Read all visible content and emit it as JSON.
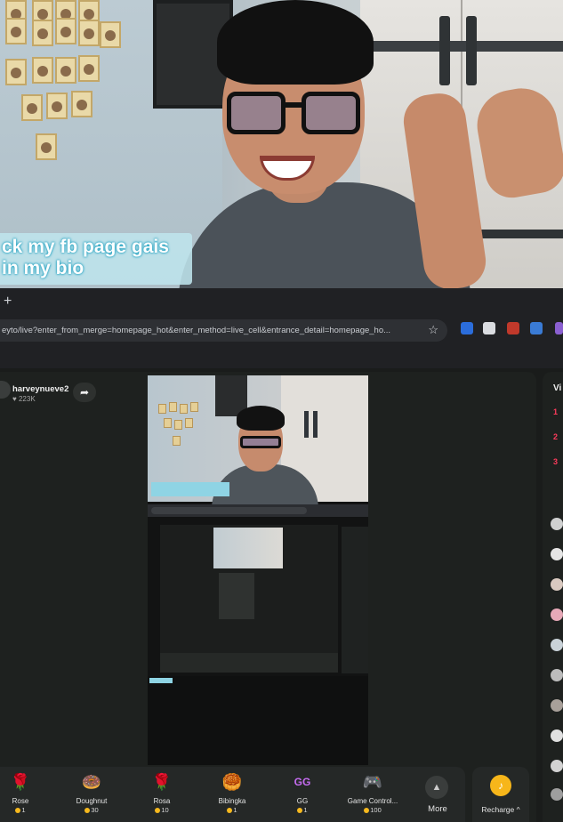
{
  "caption": {
    "line1": "ck my fb page gais",
    "line2": "in my bio"
  },
  "browser": {
    "new_tab": "+",
    "url": "eyto/live?enter_from_merge=homepage_hot&enter_method=live_cell&entrance_detail=homepage_ho...",
    "bookmark_icon": "star-icon"
  },
  "host": {
    "name": "harveynueve2",
    "likes": "♥ 223K",
    "share_icon": "share-arrow-icon"
  },
  "viewers": {
    "title": "Vi",
    "ranks": [
      "1",
      "2",
      "3"
    ]
  },
  "gifts": [
    {
      "name": "Rose",
      "price": "1",
      "icon": "rose-icon",
      "glyph": "🌹",
      "color": "#d91f3a"
    },
    {
      "name": "Doughnut",
      "price": "30",
      "icon": "doughnut-icon",
      "glyph": "🍩",
      "color": "#f2a2c3"
    },
    {
      "name": "Rosa",
      "price": "10",
      "icon": "rosa-icon",
      "glyph": "🌹",
      "color": "#c0182c"
    },
    {
      "name": "Bibingka",
      "price": "1",
      "icon": "bibingka-icon",
      "glyph": "🥮",
      "color": "#e2a12a"
    },
    {
      "name": "GG",
      "price": "1",
      "icon": "gg-icon",
      "glyph": "GG",
      "color": "#a05ce8"
    },
    {
      "name": "Game Control...",
      "price": "100",
      "icon": "game-controller-icon",
      "glyph": "🎮",
      "color": "#7fa7e6"
    }
  ],
  "more": {
    "label": "More",
    "icon": "chevron-up-icon"
  },
  "recharge": {
    "label": "Recharge ^",
    "icon": "coin-icon"
  },
  "colors": {
    "caption_glow": "#1da0c0",
    "rank": "#ff3b5c",
    "coin": "#f6b91e",
    "panel": "#1e211f"
  }
}
